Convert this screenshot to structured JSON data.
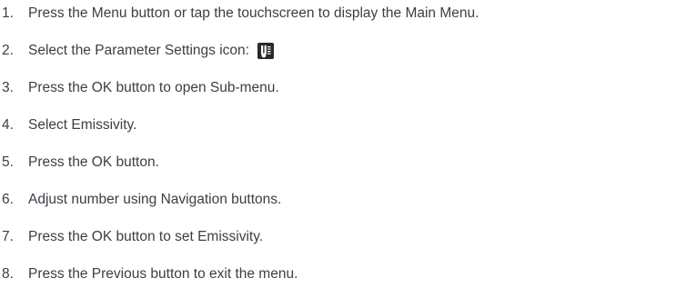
{
  "steps": [
    {
      "num": "1.",
      "text": "Press the Menu button or tap the touchscreen to display the Main Menu."
    },
    {
      "num": "2.",
      "text": "Select the Parameter Settings icon:",
      "icon": "parameter-settings-thermometer-icon"
    },
    {
      "num": "3.",
      "text": "Press the OK button to open Sub-menu."
    },
    {
      "num": "4.",
      "text": "Select Emissivity."
    },
    {
      "num": "5.",
      "text": "Press the OK button."
    },
    {
      "num": "6.",
      "text": "Adjust number using Navigation buttons."
    },
    {
      "num": "7.",
      "text": "Press the OK button to set Emissivity."
    },
    {
      "num": "8.",
      "text": "Press the Previous button to exit the menu."
    }
  ]
}
